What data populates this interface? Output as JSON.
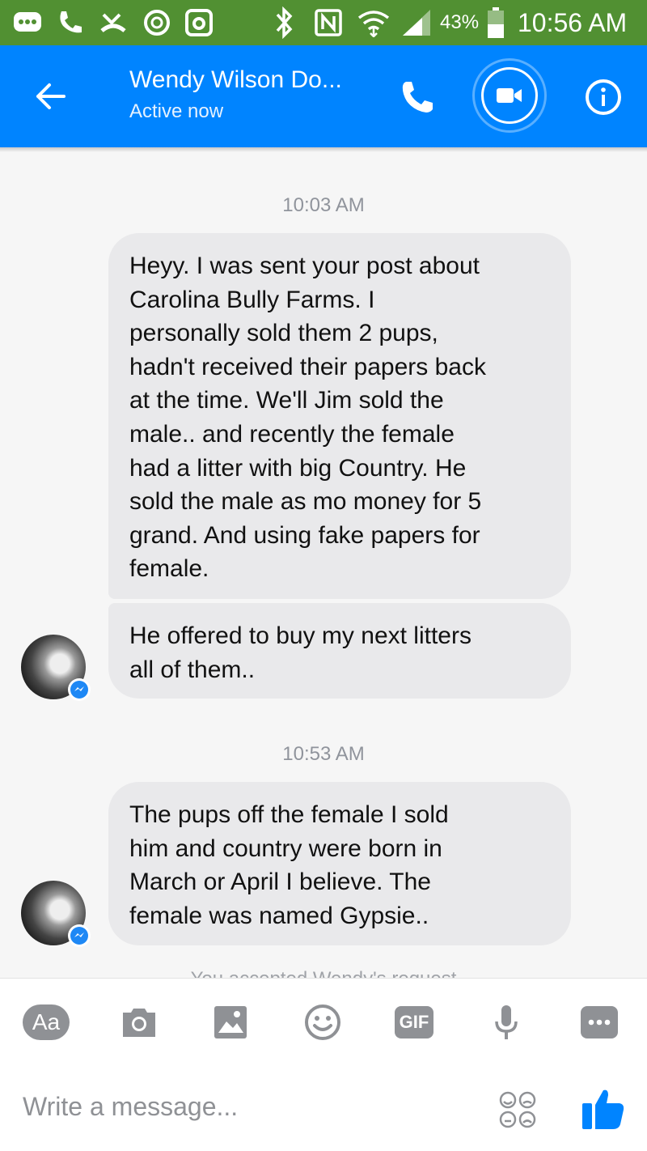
{
  "status_bar": {
    "battery_percent": "43%",
    "time": "10:56 AM",
    "icons": [
      "messenger-icon",
      "call-icon",
      "missed-call-icon",
      "power-icon",
      "instagram-icon",
      "bluetooth-icon",
      "nfc-icon",
      "wifi-icon",
      "signal-icon",
      "battery-icon"
    ]
  },
  "header": {
    "contact_name": "Wendy Wilson Do...",
    "status": "Active now"
  },
  "conversation": {
    "timestamp_1": "10:03 AM",
    "message_1_lines": [
      "Heyy. I was sent your post about",
      "Carolina Bully Farms. I",
      "personally sold them 2 pups,",
      "hadn't received their papers back",
      "at the time. We'll Jim sold the",
      "male.. and recently the female",
      "had a litter with big Country.  He",
      "sold the male as mo money for 5",
      "grand. And using fake papers for",
      "female."
    ],
    "message_2_lines": [
      "He offered to buy my next litters",
      "all of them.."
    ],
    "timestamp_2": "10:53 AM",
    "message_3_lines": [
      "The pups off the female I sold",
      "him and country were born in",
      "March or April I believe. The",
      "female was named Gypsie.."
    ],
    "notice": "You accepted Wendy's request"
  },
  "composer": {
    "aa_label": "Aa",
    "gif_label": "GIF",
    "placeholder": "Write a message..."
  },
  "colors": {
    "status_bar": "#519032",
    "header": "#0084ff",
    "bubble": "#e9e9eb",
    "tool_gray": "#8f9195"
  }
}
